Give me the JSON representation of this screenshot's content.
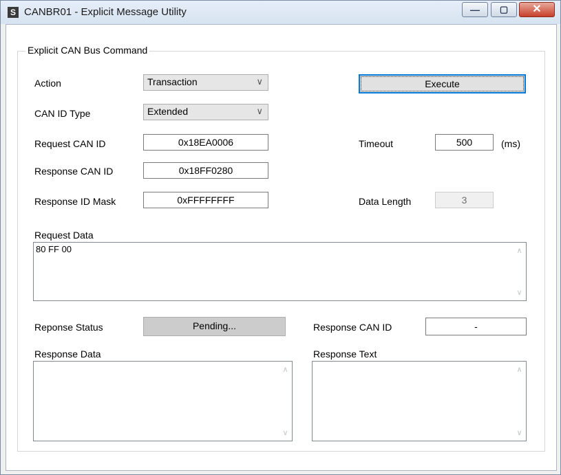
{
  "window": {
    "title": "CANBR01 - Explicit Message Utility",
    "app_icon_letter": "S"
  },
  "group": {
    "title": "Explicit CAN Bus Command"
  },
  "form": {
    "action_label": "Action",
    "action_value": "Transaction",
    "can_id_type_label": "CAN ID Type",
    "can_id_type_value": "Extended",
    "request_can_id_label": "Request CAN ID",
    "request_can_id_value": "0x18EA0006",
    "response_can_id_label": "Response CAN ID",
    "response_can_id_value": "0x18FF0280",
    "response_id_mask_label": "Response ID Mask",
    "response_id_mask_value": "0xFFFFFFFF",
    "execute_label": "Execute",
    "timeout_label": "Timeout",
    "timeout_value": "500",
    "timeout_unit": "(ms)",
    "data_length_label": "Data Length",
    "data_length_value": "3",
    "request_data_label": "Request Data",
    "request_data_value": "80 FF 00"
  },
  "response": {
    "status_label": "Reponse Status",
    "status_value": "Pending...",
    "can_id_label": "Response CAN ID",
    "can_id_value": "-",
    "data_label": "Response Data",
    "data_value": "",
    "text_label": "Response Text",
    "text_value": ""
  },
  "icons": {
    "minimize": "minimize-icon",
    "maximize": "maximize-icon",
    "close": "close-icon",
    "dropdown": "chevron-down-icon",
    "scroll_up": "scroll-up-icon",
    "scroll_down": "scroll-down-icon"
  },
  "colors": {
    "title_bar": "#d7e3f1",
    "close_button": "#c7402a",
    "focus_border": "#0078d7",
    "status_background": "#cccccc"
  }
}
